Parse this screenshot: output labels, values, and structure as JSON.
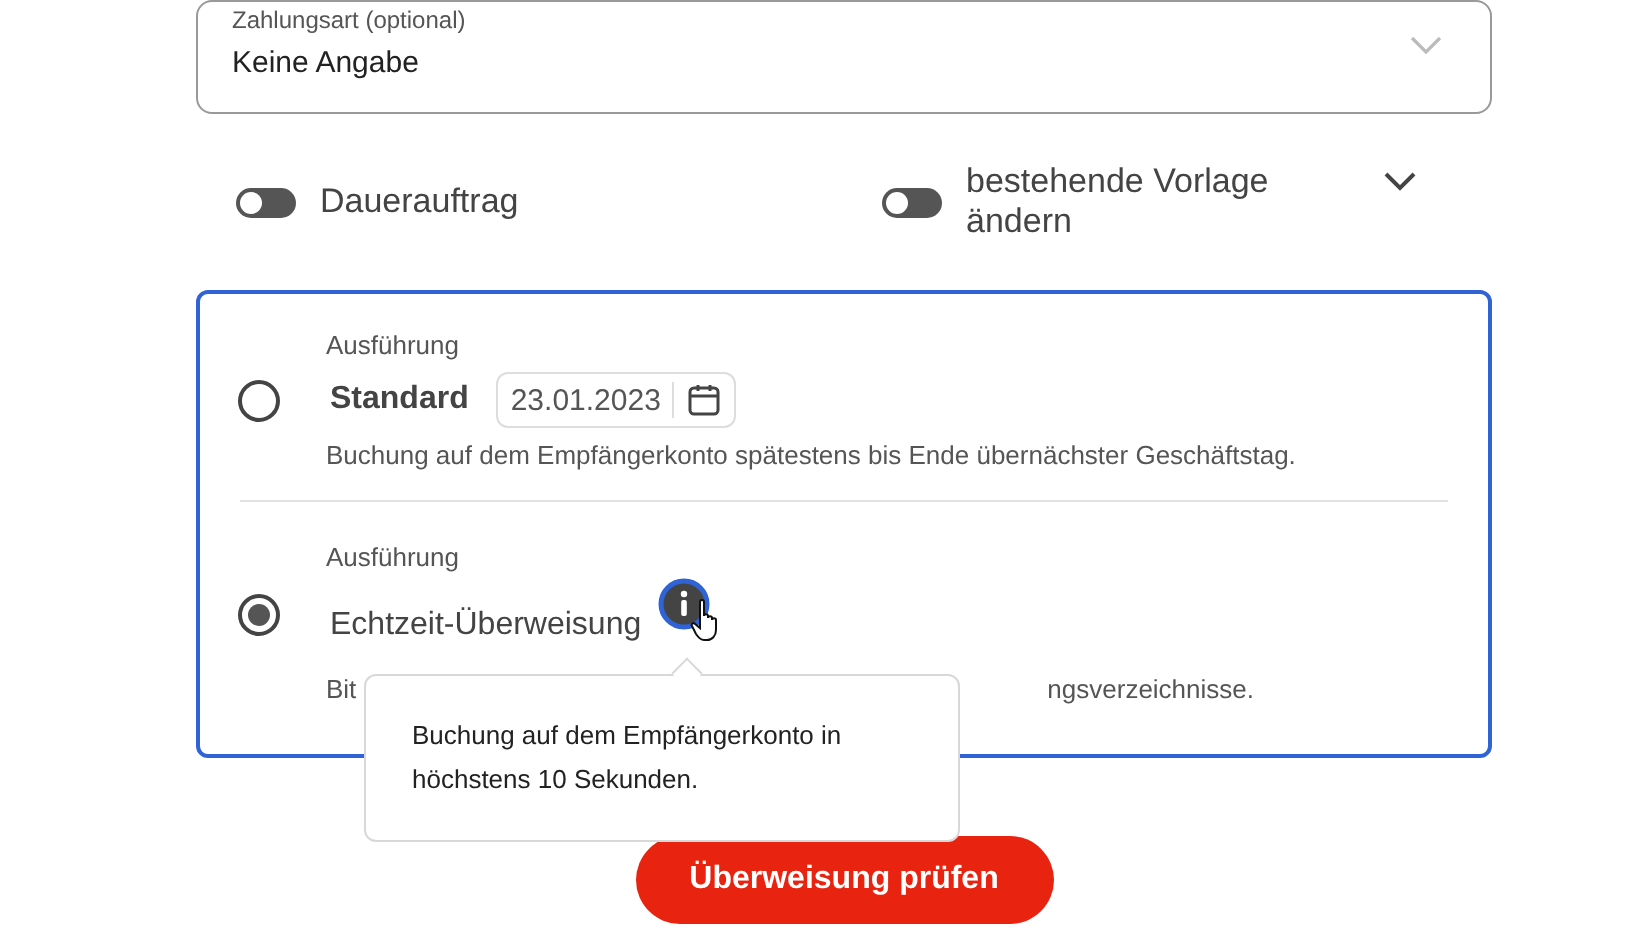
{
  "payment_type": {
    "label": "Zahlungsart (optional)",
    "value": "Keine Angabe"
  },
  "toggles": [
    {
      "label": "Dauerauftrag",
      "on": false
    },
    {
      "label": "bestehende Vorlage ändern",
      "on": false
    }
  ],
  "options": [
    {
      "kind": "date",
      "label": "Ausführung",
      "title": "Standard",
      "selected": false,
      "date": "23.01.2023",
      "description": "Buchung auf dem Empfängerkonto spätestens bis Ende übernächster Geschäftstag."
    },
    {
      "kind": "info",
      "label": "Ausführung",
      "title": "Echtzeit-Überweisung",
      "selected": true,
      "description_parts": [
        "Bit",
        "ngsverzeichnisse."
      ],
      "tooltip": "Buchung auf dem Empfängerkonto in höchstens 10 Sekunden."
    }
  ],
  "submit": "Überweisung prüfen"
}
